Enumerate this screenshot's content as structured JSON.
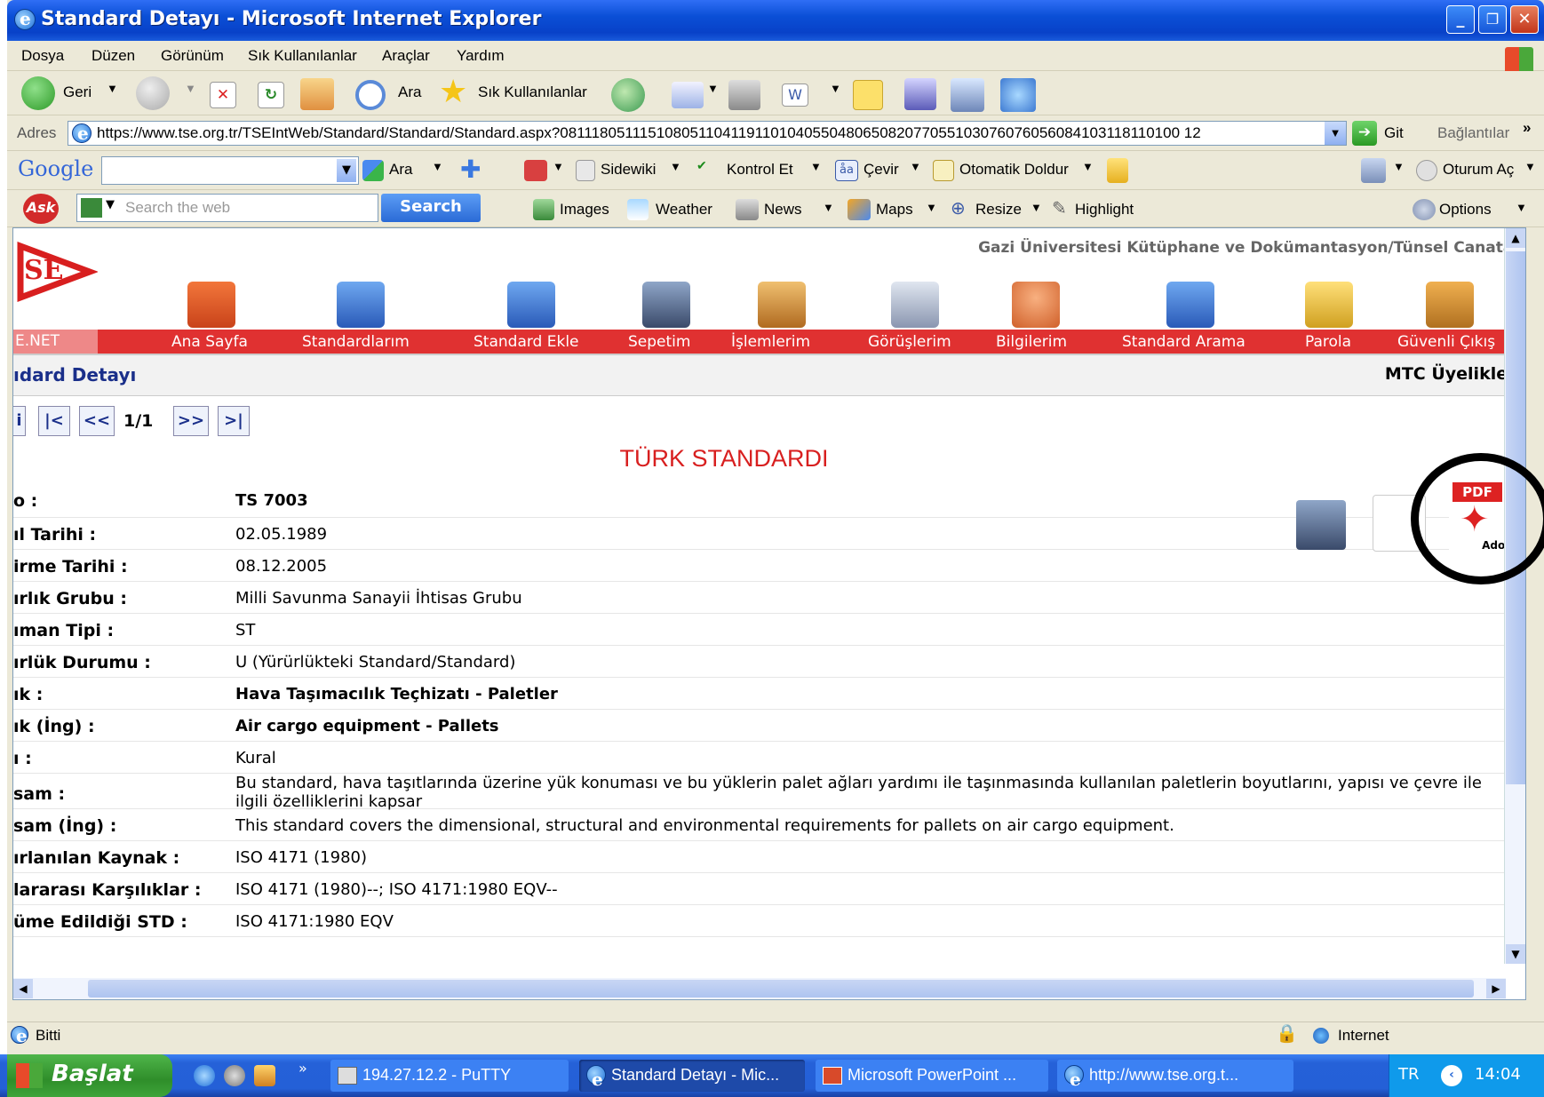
{
  "window": {
    "title": "Standard Detayı - Microsoft Internet Explorer",
    "controls": {
      "minimize": "_",
      "maximize": "❐",
      "close": "✕"
    }
  },
  "menu": [
    "Dosya",
    "Düzen",
    "Görünüm",
    "Sık Kullanılanlar",
    "Araçlar",
    "Yardım"
  ],
  "toolbar": {
    "back": "Geri",
    "search": "Ara",
    "favorites": "Sık Kullanılanlar"
  },
  "address": {
    "label": "Adres",
    "url": "https://www.tse.org.tr/TSEIntWeb/Standard/Standard/Standard.aspx?081118051115108051104119110104055048065082077055103076076056084103118110100 12",
    "go": "Git",
    "links": "Bağlantılar",
    "more": "»"
  },
  "google_bar": {
    "logo": "Google",
    "search": "Ara",
    "sidewiki": "Sidewiki",
    "spellcheck": "Kontrol Et",
    "translate": "Çevir",
    "autofill": "Otomatik Doldur",
    "signin": "Oturum Aç"
  },
  "ask_bar": {
    "logo": "Ask",
    "placeholder": "Search the web",
    "search_btn": "Search",
    "images": "Images",
    "weather": "Weather",
    "news": "News",
    "maps": "Maps",
    "resize": "Resize",
    "highlight": "Highlight",
    "options": "Options"
  },
  "site": {
    "university": "Gazi Üniversitesi Kütüphane ve Dokümantasyon/Tünsel Canatalı",
    "logo_text": "SE",
    "logo_sub": "E.NET",
    "nav": [
      "Ana Sayfa",
      "Standardlarım",
      "Standard Ekle",
      "Sepetim",
      "İşlemlerim",
      "Görüşlerim",
      "Bilgilerim",
      "Standard Arama",
      "Parola",
      "Güvenli Çıkış"
    ],
    "page_title": "ıdard Detayı",
    "mtc": "MTC Üyelikleri"
  },
  "pager": {
    "first_partial": "i",
    "first": "|<",
    "prev": "<<",
    "page": "1/1",
    "next": ">>",
    "last": ">|"
  },
  "heading": "TÜRK STANDARDI",
  "details": [
    {
      "label": "o :",
      "value": "TS 7003",
      "bold": true
    },
    {
      "label": "ıl Tarihi :",
      "value": "02.05.1989",
      "bold": false
    },
    {
      "label": "irme Tarihi :",
      "value": "08.12.2005",
      "bold": false
    },
    {
      "label": "ırlık Grubu :",
      "value": "Milli Savunma Sanayii İhtisas Grubu",
      "bold": false
    },
    {
      "label": "ıman Tipi :",
      "value": "ST",
      "bold": false
    },
    {
      "label": "ırlük Durumu :",
      "value": "U (Yürürlükteki Standard/Standard)",
      "bold": false
    },
    {
      "label": "ık :",
      "value": "Hava Taşımacılık Teçhizatı - Paletler",
      "bold": true
    },
    {
      "label": "ık (İng) :",
      "value": "Air cargo equipment - Pallets",
      "bold": true
    },
    {
      "label": "ı :",
      "value": "Kural",
      "bold": false
    },
    {
      "label": "sam :",
      "value": "Bu standard, hava taşıtlarında üzerine yük konuması ve bu yüklerin palet ağları yardımı ile taşınmasında kullanılan paletlerin boyutlarını, yapısı ve çevre ile ilgili özelliklerini kapsar",
      "bold": false
    },
    {
      "label": "sam (İng) :",
      "value": "This standard covers the dimensional, structural and environmental requirements for pallets on air cargo equipment.",
      "bold": false
    },
    {
      "label": "ırlanılan Kaynak :",
      "value": "ISO 4171 (1980)",
      "bold": false
    },
    {
      "label": "lararası Karşılıklar :",
      "value": "ISO 4171 (1980)--; ISO 4171:1980 EQV--",
      "bold": false
    },
    {
      "label": "üme Edildiği STD :",
      "value": "ISO 4171:1980 EQV",
      "bold": false
    }
  ],
  "actions": {
    "pdf_label": "PDF",
    "adobe_label": "Adobe"
  },
  "status": {
    "text": "Bitti",
    "zone": "Internet"
  },
  "taskbar": {
    "start": "Başlat",
    "tasks": [
      "194.27.12.2 - PuTTY",
      "Standard Detayı - Mic...",
      "Microsoft PowerPoint ...",
      "http://www.tse.org.t..."
    ],
    "lang": "TR",
    "clock": "14:04",
    "overflow": "»"
  }
}
